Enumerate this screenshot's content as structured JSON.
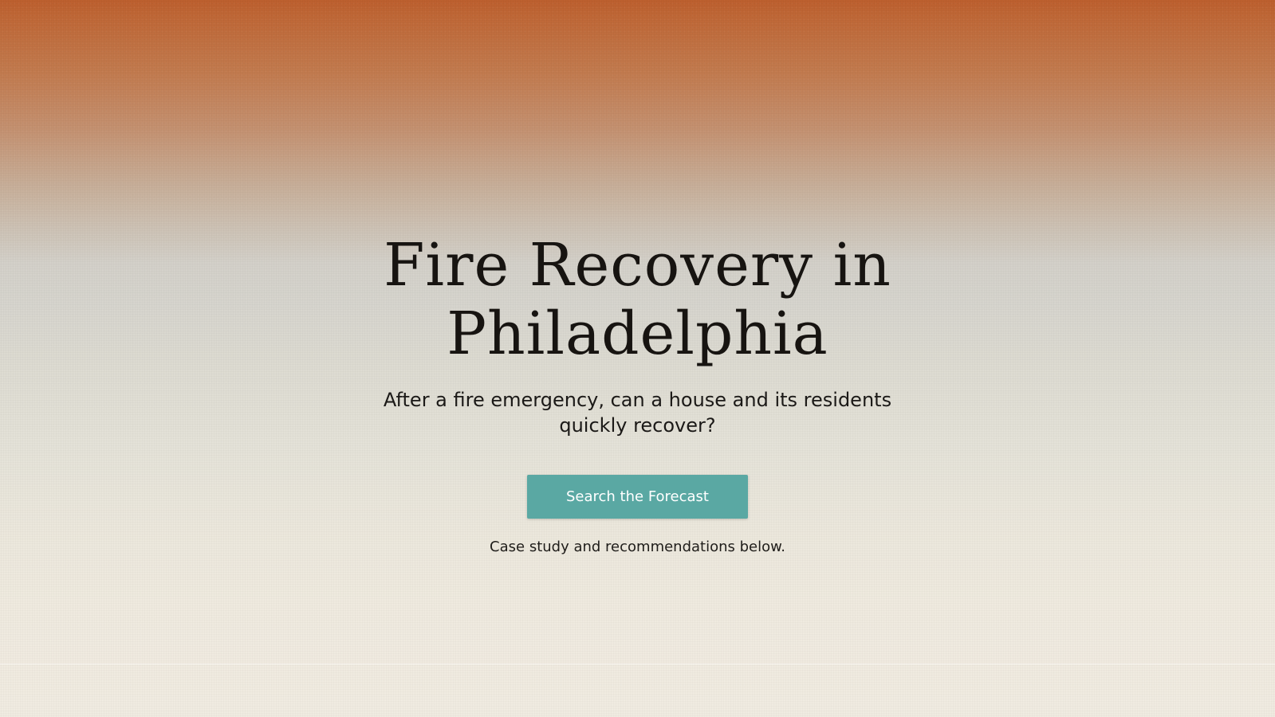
{
  "hero": {
    "title": "Fire Recovery in Philadelphia",
    "subtitle": "After a fire emergency, can a house and its residents quickly recover?",
    "cta_label": "Search the Forecast",
    "note": "Case study and recommendations below."
  },
  "colors": {
    "top_gradient": "#bd5f2e",
    "bottom_background": "#f0ebe1",
    "button": "#5aa8a3",
    "text": "#171411"
  }
}
